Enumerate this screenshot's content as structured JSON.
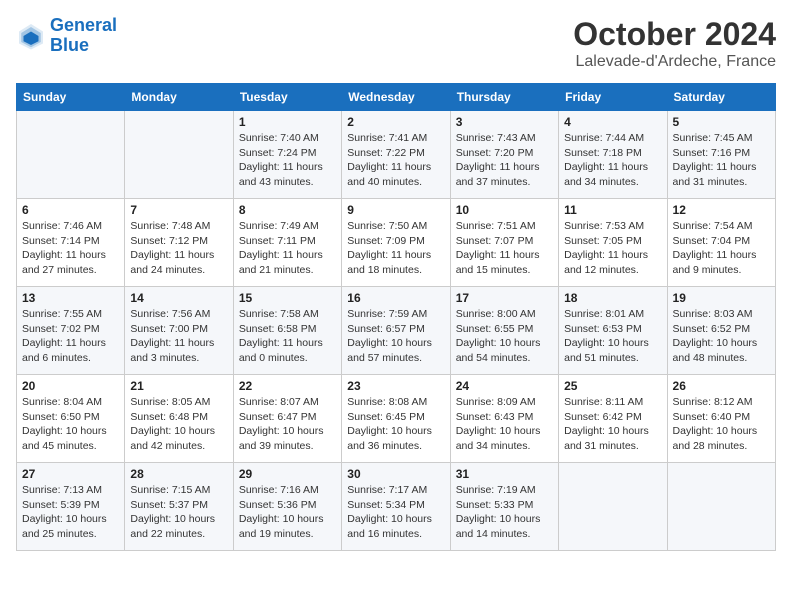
{
  "header": {
    "logo_line1": "General",
    "logo_line2": "Blue",
    "month": "October 2024",
    "location": "Lalevade-d'Ardeche, France"
  },
  "days_of_week": [
    "Sunday",
    "Monday",
    "Tuesday",
    "Wednesday",
    "Thursday",
    "Friday",
    "Saturday"
  ],
  "weeks": [
    [
      {
        "day": "",
        "info": ""
      },
      {
        "day": "",
        "info": ""
      },
      {
        "day": "1",
        "info": "Sunrise: 7:40 AM\nSunset: 7:24 PM\nDaylight: 11 hours\nand 43 minutes."
      },
      {
        "day": "2",
        "info": "Sunrise: 7:41 AM\nSunset: 7:22 PM\nDaylight: 11 hours\nand 40 minutes."
      },
      {
        "day": "3",
        "info": "Sunrise: 7:43 AM\nSunset: 7:20 PM\nDaylight: 11 hours\nand 37 minutes."
      },
      {
        "day": "4",
        "info": "Sunrise: 7:44 AM\nSunset: 7:18 PM\nDaylight: 11 hours\nand 34 minutes."
      },
      {
        "day": "5",
        "info": "Sunrise: 7:45 AM\nSunset: 7:16 PM\nDaylight: 11 hours\nand 31 minutes."
      }
    ],
    [
      {
        "day": "6",
        "info": "Sunrise: 7:46 AM\nSunset: 7:14 PM\nDaylight: 11 hours\nand 27 minutes."
      },
      {
        "day": "7",
        "info": "Sunrise: 7:48 AM\nSunset: 7:12 PM\nDaylight: 11 hours\nand 24 minutes."
      },
      {
        "day": "8",
        "info": "Sunrise: 7:49 AM\nSunset: 7:11 PM\nDaylight: 11 hours\nand 21 minutes."
      },
      {
        "day": "9",
        "info": "Sunrise: 7:50 AM\nSunset: 7:09 PM\nDaylight: 11 hours\nand 18 minutes."
      },
      {
        "day": "10",
        "info": "Sunrise: 7:51 AM\nSunset: 7:07 PM\nDaylight: 11 hours\nand 15 minutes."
      },
      {
        "day": "11",
        "info": "Sunrise: 7:53 AM\nSunset: 7:05 PM\nDaylight: 11 hours\nand 12 minutes."
      },
      {
        "day": "12",
        "info": "Sunrise: 7:54 AM\nSunset: 7:04 PM\nDaylight: 11 hours\nand 9 minutes."
      }
    ],
    [
      {
        "day": "13",
        "info": "Sunrise: 7:55 AM\nSunset: 7:02 PM\nDaylight: 11 hours\nand 6 minutes."
      },
      {
        "day": "14",
        "info": "Sunrise: 7:56 AM\nSunset: 7:00 PM\nDaylight: 11 hours\nand 3 minutes."
      },
      {
        "day": "15",
        "info": "Sunrise: 7:58 AM\nSunset: 6:58 PM\nDaylight: 11 hours\nand 0 minutes."
      },
      {
        "day": "16",
        "info": "Sunrise: 7:59 AM\nSunset: 6:57 PM\nDaylight: 10 hours\nand 57 minutes."
      },
      {
        "day": "17",
        "info": "Sunrise: 8:00 AM\nSunset: 6:55 PM\nDaylight: 10 hours\nand 54 minutes."
      },
      {
        "day": "18",
        "info": "Sunrise: 8:01 AM\nSunset: 6:53 PM\nDaylight: 10 hours\nand 51 minutes."
      },
      {
        "day": "19",
        "info": "Sunrise: 8:03 AM\nSunset: 6:52 PM\nDaylight: 10 hours\nand 48 minutes."
      }
    ],
    [
      {
        "day": "20",
        "info": "Sunrise: 8:04 AM\nSunset: 6:50 PM\nDaylight: 10 hours\nand 45 minutes."
      },
      {
        "day": "21",
        "info": "Sunrise: 8:05 AM\nSunset: 6:48 PM\nDaylight: 10 hours\nand 42 minutes."
      },
      {
        "day": "22",
        "info": "Sunrise: 8:07 AM\nSunset: 6:47 PM\nDaylight: 10 hours\nand 39 minutes."
      },
      {
        "day": "23",
        "info": "Sunrise: 8:08 AM\nSunset: 6:45 PM\nDaylight: 10 hours\nand 36 minutes."
      },
      {
        "day": "24",
        "info": "Sunrise: 8:09 AM\nSunset: 6:43 PM\nDaylight: 10 hours\nand 34 minutes."
      },
      {
        "day": "25",
        "info": "Sunrise: 8:11 AM\nSunset: 6:42 PM\nDaylight: 10 hours\nand 31 minutes."
      },
      {
        "day": "26",
        "info": "Sunrise: 8:12 AM\nSunset: 6:40 PM\nDaylight: 10 hours\nand 28 minutes."
      }
    ],
    [
      {
        "day": "27",
        "info": "Sunrise: 7:13 AM\nSunset: 5:39 PM\nDaylight: 10 hours\nand 25 minutes."
      },
      {
        "day": "28",
        "info": "Sunrise: 7:15 AM\nSunset: 5:37 PM\nDaylight: 10 hours\nand 22 minutes."
      },
      {
        "day": "29",
        "info": "Sunrise: 7:16 AM\nSunset: 5:36 PM\nDaylight: 10 hours\nand 19 minutes."
      },
      {
        "day": "30",
        "info": "Sunrise: 7:17 AM\nSunset: 5:34 PM\nDaylight: 10 hours\nand 16 minutes."
      },
      {
        "day": "31",
        "info": "Sunrise: 7:19 AM\nSunset: 5:33 PM\nDaylight: 10 hours\nand 14 minutes."
      },
      {
        "day": "",
        "info": ""
      },
      {
        "day": "",
        "info": ""
      }
    ]
  ]
}
